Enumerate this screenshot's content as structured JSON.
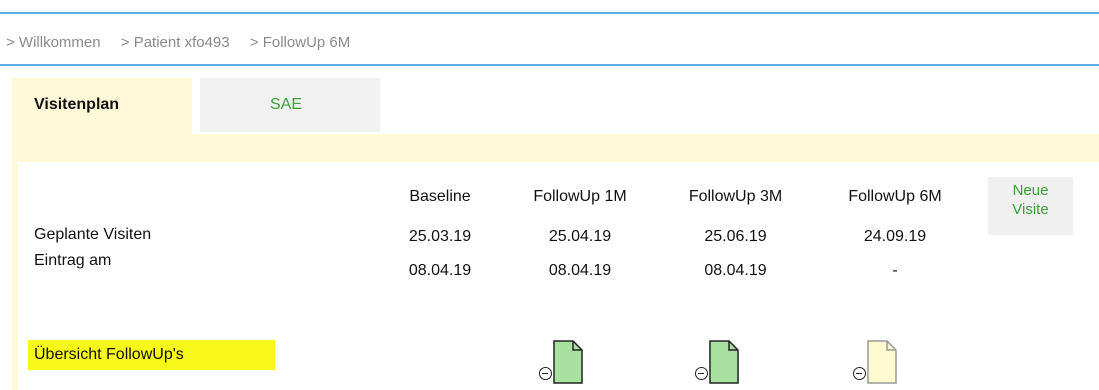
{
  "breadcrumb": [
    {
      "label": "> Willkommen"
    },
    {
      "label": "> Patient xfo493"
    },
    {
      "label": "> FollowUp 6M"
    }
  ],
  "tabs": [
    {
      "label": "Visitenplan",
      "active": true
    },
    {
      "label": "SAE",
      "active": false
    }
  ],
  "schedule": {
    "row_labels": {
      "planned": "Geplante Visiten",
      "entered": "Eintrag am"
    },
    "visits": [
      {
        "name": "Baseline",
        "planned": "25.03.19",
        "entered": "08.04.19"
      },
      {
        "name": "FollowUp 1M",
        "planned": "25.04.19",
        "entered": "08.04.19"
      },
      {
        "name": "FollowUp 3M",
        "planned": "25.06.19",
        "entered": "08.04.19"
      },
      {
        "name": "FollowUp 6M",
        "planned": "24.09.19",
        "entered": "-"
      }
    ],
    "new_visit_line1": "Neue",
    "new_visit_line2": "Visite"
  },
  "overview": {
    "label": "Übersicht FollowUp's",
    "items": [
      {
        "visit": "FollowUp 1M",
        "icon": "document-completed-icon",
        "status_color": "#a8e0a0"
      },
      {
        "visit": "FollowUp 3M",
        "icon": "document-completed-icon",
        "status_color": "#a8e0a0"
      },
      {
        "visit": "FollowUp 6M",
        "icon": "document-pending-icon",
        "status_color": "#fffad0"
      }
    ]
  },
  "colors": {
    "accent_blue": "#5aaee6",
    "tab_bg": "#fff9d9",
    "link_green": "#3aa13a",
    "highlight": "#f7f71a"
  }
}
